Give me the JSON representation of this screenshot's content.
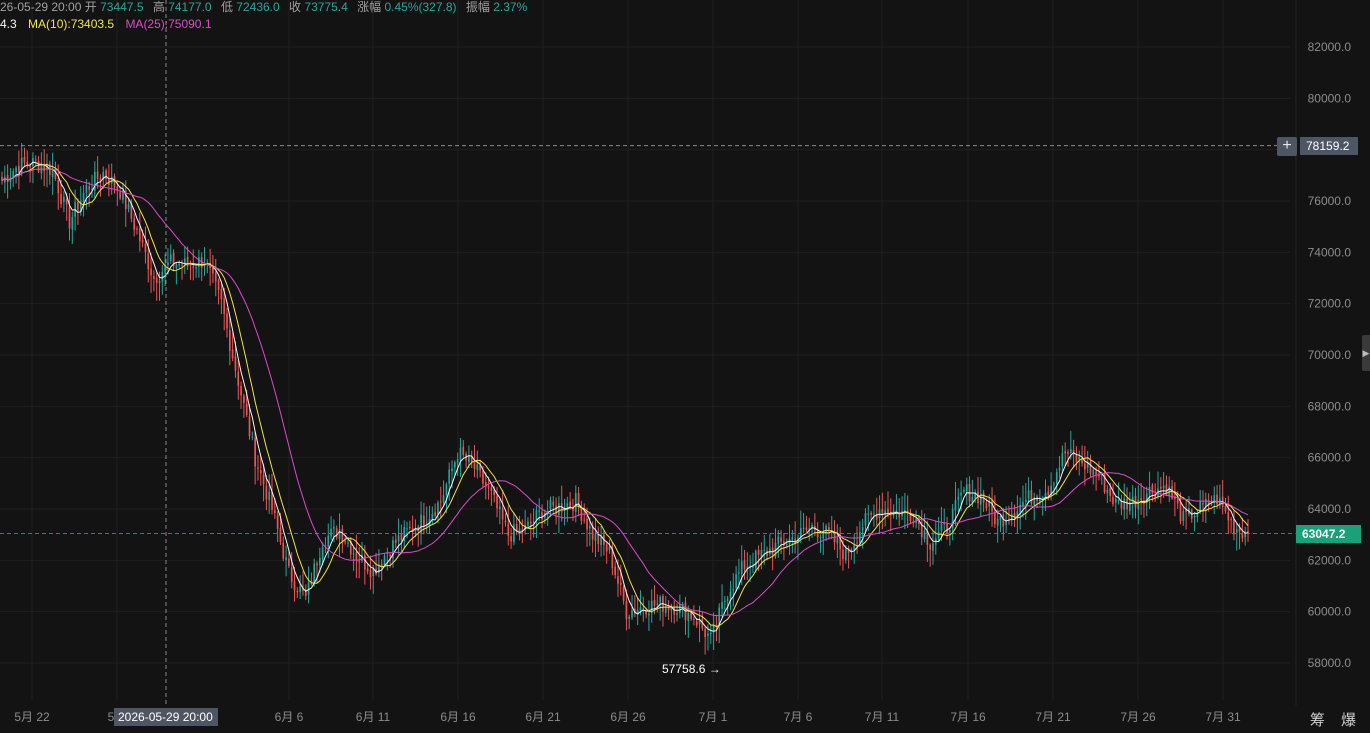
{
  "ohlc": {
    "datetime": "26-05-29 20:00",
    "open_label": "开",
    "open": "73447.5",
    "high_label": "高",
    "high": "74177.0",
    "low_label": "低",
    "low": "72436.0",
    "close_label": "收",
    "close": "73775.4",
    "change_label": "涨幅",
    "change": "0.45%(327.8)",
    "amplitude_label": "振幅",
    "amplitude": "2.37%"
  },
  "ma": {
    "ma5_fragment": "4.3",
    "ma10": "MA(10):73403.5",
    "ma25": "MA(25):75090.1"
  },
  "crosshair": {
    "price_label": "78159.2",
    "time_label": "2026-05-29 20:00"
  },
  "current_price_label": "63047.2",
  "low_marker_label": "57758.6 →",
  "tools": {
    "label": "筹 爆"
  },
  "colors": {
    "up": "#26a69a",
    "down": "#ef5350",
    "ma5": "#f5f5f5",
    "ma10": "#f0e442",
    "ma25": "#d94cc7",
    "grid": "#1f1f1f",
    "current_price_bg": "#1aa17a",
    "crosshair_tag_bg": "#4e5663"
  },
  "chart_data": {
    "type": "candlestick",
    "interval": "4h",
    "y_axis_ticks": [
      "82000.0",
      "80000.0",
      "78000.0",
      "76000.0",
      "74000.0",
      "72000.0",
      "70000.0",
      "68000.0",
      "66000.0",
      "64000.0",
      "62000.0",
      "60000.0",
      "58000.0"
    ],
    "ylim": [
      56500,
      83600
    ],
    "x_axis_ticks": [
      "5月 22",
      "5月",
      "6月 6",
      "6月 11",
      "6月 16",
      "6月 21",
      "6月 26",
      "7月 1",
      "7月 6",
      "7月 11",
      "7月 16",
      "7月 21",
      "7月 26",
      "7月 31"
    ],
    "x_start": "2026-05-20 00:00",
    "x_end": "2026-08-01 20:00",
    "ma_periods": [
      5,
      10,
      25
    ],
    "close_anchors": [
      [
        "2026-05-20 00:00",
        76800
      ],
      [
        "2026-05-21 00:00",
        77400
      ],
      [
        "2026-05-22 00:00",
        77500
      ],
      [
        "2026-05-23 00:00",
        77200
      ],
      [
        "2026-05-24 00:00",
        75200
      ],
      [
        "2026-05-25 00:00",
        76500
      ],
      [
        "2026-05-26 00:00",
        77100
      ],
      [
        "2026-05-27 00:00",
        76400
      ],
      [
        "2026-05-28 00:00",
        74800
      ],
      [
        "2026-05-29 00:00",
        73000
      ],
      [
        "2026-05-30 00:00",
        73600
      ],
      [
        "2026-05-31 00:00",
        73500
      ],
      [
        "2026-06-01 00:00",
        73700
      ],
      [
        "2026-06-02 00:00",
        72000
      ],
      [
        "2026-06-03 00:00",
        69000
      ],
      [
        "2026-06-04 00:00",
        66000
      ],
      [
        "2026-06-05 00:00",
        64000
      ],
      [
        "2026-06-06 00:00",
        61500
      ],
      [
        "2026-06-07 00:00",
        60500
      ],
      [
        "2026-06-08 00:00",
        62800
      ],
      [
        "2026-06-09 00:00",
        63200
      ],
      [
        "2026-06-10 00:00",
        62200
      ],
      [
        "2026-06-11 00:00",
        61600
      ],
      [
        "2026-06-12 00:00",
        62500
      ],
      [
        "2026-06-13 00:00",
        63100
      ],
      [
        "2026-06-14 00:00",
        63600
      ],
      [
        "2026-06-15 00:00",
        64300
      ],
      [
        "2026-06-16 00:00",
        66200
      ],
      [
        "2026-06-17 00:00",
        65600
      ],
      [
        "2026-06-18 00:00",
        64500
      ],
      [
        "2026-06-19 00:00",
        63000
      ],
      [
        "2026-06-20 00:00",
        63200
      ],
      [
        "2026-06-21 00:00",
        63900
      ],
      [
        "2026-06-22 00:00",
        64100
      ],
      [
        "2026-06-23 00:00",
        64300
      ],
      [
        "2026-06-24 00:00",
        63000
      ],
      [
        "2026-06-25 00:00",
        62300
      ],
      [
        "2026-06-26 00:00",
        60000
      ],
      [
        "2026-06-27 00:00",
        60200
      ],
      [
        "2026-06-28 00:00",
        60300
      ],
      [
        "2026-06-29 00:00",
        60200
      ],
      [
        "2026-06-30 00:00",
        59800
      ],
      [
        "2026-07-01 00:00",
        58900
      ],
      [
        "2026-07-02 00:00",
        60800
      ],
      [
        "2026-07-03 00:00",
        61800
      ],
      [
        "2026-07-04 00:00",
        62200
      ],
      [
        "2026-07-05 00:00",
        62600
      ],
      [
        "2026-07-06 00:00",
        62900
      ],
      [
        "2026-07-07 00:00",
        63300
      ],
      [
        "2026-07-08 00:00",
        63000
      ],
      [
        "2026-07-09 00:00",
        62200
      ],
      [
        "2026-07-10 00:00",
        63400
      ],
      [
        "2026-07-11 00:00",
        64000
      ],
      [
        "2026-07-12 00:00",
        63900
      ],
      [
        "2026-07-13 00:00",
        63800
      ],
      [
        "2026-07-14 00:00",
        62700
      ],
      [
        "2026-07-15 00:00",
        63300
      ],
      [
        "2026-07-16 00:00",
        64700
      ],
      [
        "2026-07-17 00:00",
        64500
      ],
      [
        "2026-07-18 00:00",
        63500
      ],
      [
        "2026-07-19 00:00",
        64000
      ],
      [
        "2026-07-20 00:00",
        64500
      ],
      [
        "2026-07-21 00:00",
        64800
      ],
      [
        "2026-07-22 00:00",
        66200
      ],
      [
        "2026-07-23 00:00",
        65800
      ],
      [
        "2026-07-24 00:00",
        65300
      ],
      [
        "2026-07-25 00:00",
        64200
      ],
      [
        "2026-07-26 00:00",
        64300
      ],
      [
        "2026-07-27 00:00",
        64700
      ],
      [
        "2026-07-28 00:00",
        64900
      ],
      [
        "2026-07-29 00:00",
        63600
      ],
      [
        "2026-07-30 00:00",
        64000
      ],
      [
        "2026-07-31 00:00",
        64400
      ],
      [
        "2026-08-01 00:00",
        63300
      ],
      [
        "2026-08-01 20:00",
        63047.2
      ]
    ],
    "session_high": 78159.2,
    "session_low": 57758.6,
    "last_price": 63047.2
  }
}
